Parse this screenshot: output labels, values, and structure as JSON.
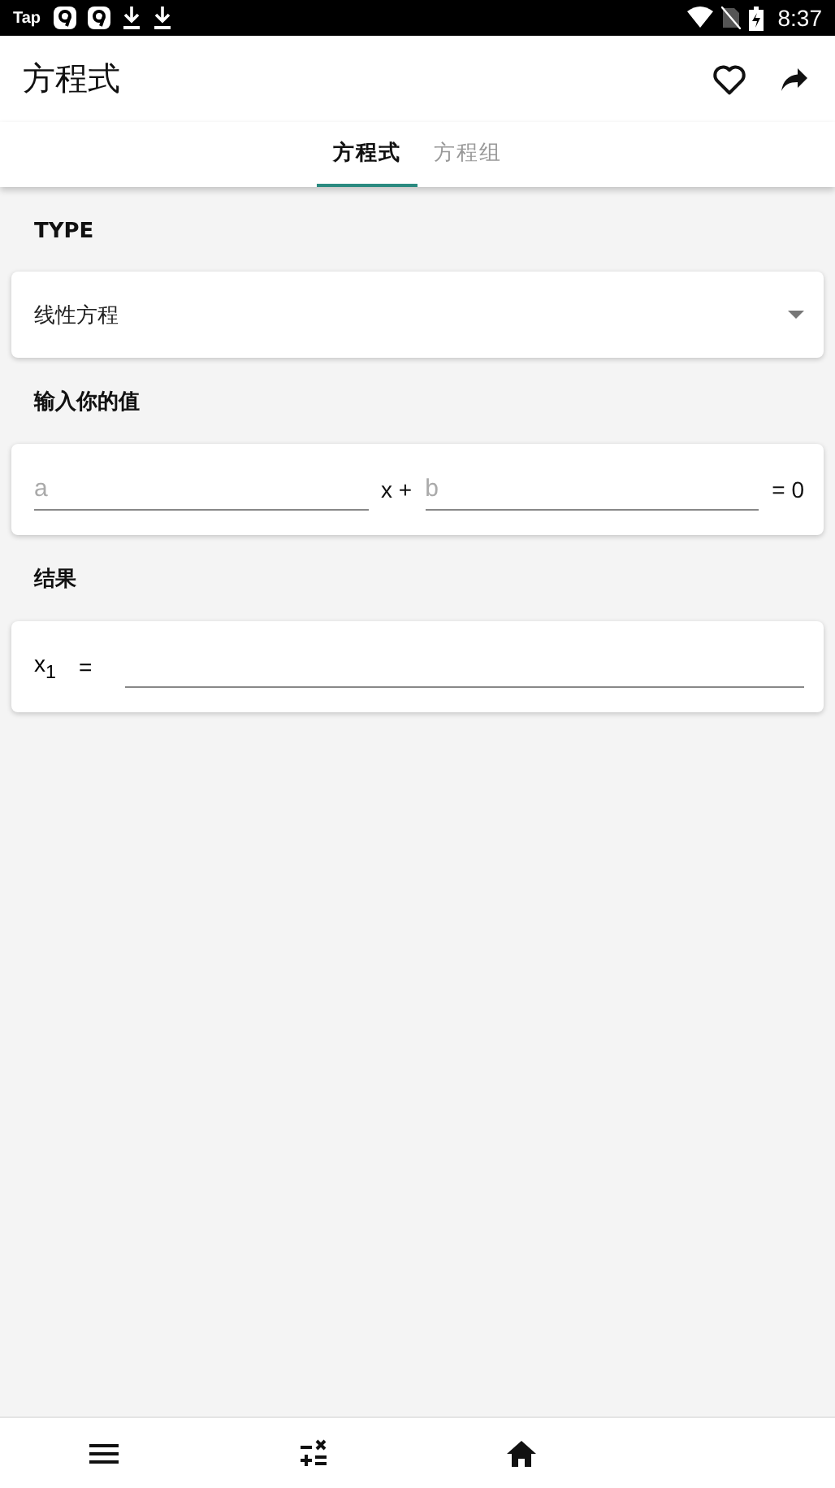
{
  "status_bar": {
    "app_label": "Tap",
    "time": "8:37"
  },
  "app_bar": {
    "title": "方程式"
  },
  "tabs": [
    {
      "label": "方程式",
      "selected": true
    },
    {
      "label": "方程组",
      "selected": false
    }
  ],
  "type_section": {
    "heading": "TYPE",
    "dropdown_value": "线性方程"
  },
  "input_section": {
    "heading": "输入你的值",
    "field_a": {
      "placeholder": "a"
    },
    "between_text": "x +",
    "field_b": {
      "placeholder": "b"
    },
    "end_text": "= 0"
  },
  "result_section": {
    "heading": "结果",
    "variable": "x$_{1}$",
    "equals": "="
  }
}
